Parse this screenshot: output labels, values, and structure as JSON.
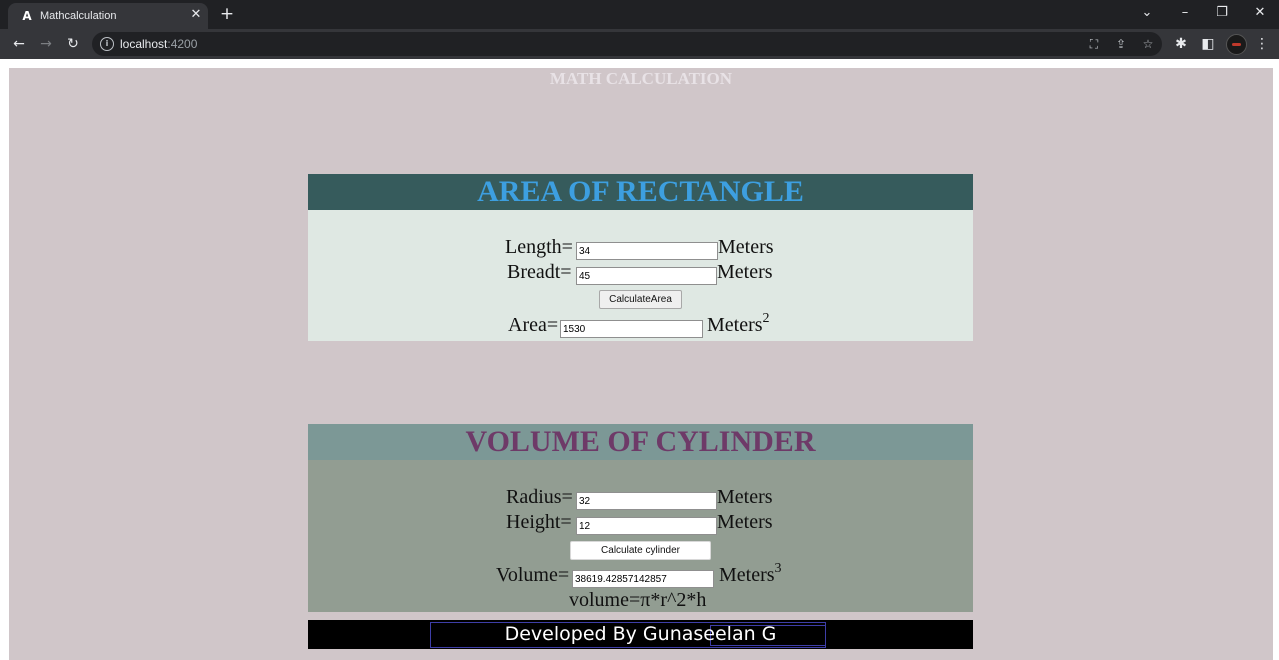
{
  "browser": {
    "tab_title": "Mathcalculation",
    "tab_favicon": "A",
    "url_host": "localhost",
    "url_port": ":4200"
  },
  "page": {
    "title": "MATH CALCULATION"
  },
  "rectangle": {
    "heading": "AREA OF RECTANGLE",
    "length_label": "Length=",
    "length_value": "34",
    "breadth_label": "Breadt=",
    "breadth_value": "45",
    "unit": "Meters",
    "button_label": "CalculateArea",
    "area_label": "Area=",
    "area_value": "1530",
    "area_unit": "Meters",
    "area_exponent": "2"
  },
  "cylinder": {
    "heading": "VOLUME OF CYLINDER",
    "radius_label": "Radius=",
    "radius_value": "32",
    "height_label": "Height=",
    "height_value": "12",
    "unit": "Meters",
    "button_label": "Calculate cylinder",
    "volume_label": "Volume=",
    "volume_value": "38619.42857142857",
    "volume_unit": "Meters",
    "volume_exponent": "3",
    "formula": "volume=π*r^2*h"
  },
  "footer": {
    "text": "Developed By Gunaseelan G"
  },
  "colors": {
    "page_bg": "#d0c6c9",
    "rect_header_bg": "#365b5c",
    "rect_header_text": "#3d9fe0",
    "rect_body_bg": "#dfe8e3",
    "cyl_header_bg": "#7c9896",
    "cyl_header_text": "#6e3a68",
    "cyl_body_bg": "#929d92",
    "footer_bg": "#000000"
  },
  "icons": {
    "back": "arrow-left-icon",
    "forward": "arrow-right-icon",
    "reload": "reload-icon",
    "info": "info-icon",
    "translate": "translate-icon",
    "share": "share-icon",
    "bookmark": "star-icon",
    "extensions": "puzzle-icon",
    "side_panel": "side-panel-icon",
    "menu": "kebab-menu-icon"
  }
}
